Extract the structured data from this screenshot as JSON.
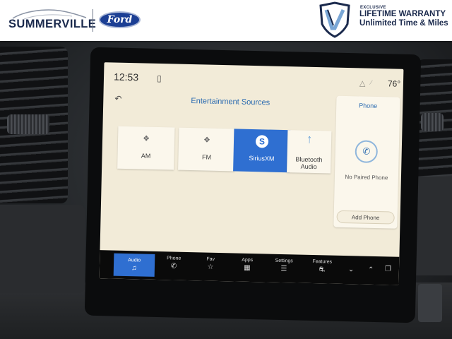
{
  "banner": {
    "dealer_name": "SUMMERVILLE",
    "brand_logo_text": "Ford",
    "warranty_eyebrow": "EXCLUSIVE",
    "warranty_title": "LIFETIME WARRANTY",
    "warranty_subtitle": "Unlimited Time & Miles"
  },
  "status_bar": {
    "time": "12:53",
    "temperature": "76°",
    "icons": [
      "phone-projection-icon",
      "wifi-icon",
      "signal-icon"
    ]
  },
  "header": {
    "back_icon": "back-arrow-icon",
    "title": "Entertainment Sources"
  },
  "sources": [
    {
      "label": "AM",
      "icon": "broadcast-icon",
      "selected": false
    },
    {
      "label": "FM",
      "icon": "broadcast-icon",
      "selected": false
    },
    {
      "label": "SiriusXM",
      "icon": "siriusxm-icon",
      "selected": true
    },
    {
      "label": "Bluetooth Audio",
      "icon": "bluetooth-icon",
      "selected": false
    }
  ],
  "phone_panel": {
    "title": "Phone",
    "status": "No Paired Phone",
    "add_button": "Add Phone"
  },
  "bottom_nav": {
    "items": [
      {
        "label": "Audio",
        "icon": "music-note-icon",
        "active": true
      },
      {
        "label": "Phone",
        "icon": "phone-icon",
        "active": false
      },
      {
        "label": "Fav",
        "icon": "star-icon",
        "active": false
      },
      {
        "label": "Apps",
        "icon": "apps-grid-icon",
        "active": false
      },
      {
        "label": "Settings",
        "icon": "sliders-icon",
        "active": false
      },
      {
        "label": "Features",
        "icon": "car-icon",
        "active": false
      }
    ],
    "extra_icons": [
      "chevron-down-icon",
      "chevron-up-icon",
      "split-screen-icon"
    ]
  },
  "colors": {
    "screen_bg": "#f2ebd8",
    "accent_blue": "#2f6fd1",
    "title_blue": "#2a6ab0",
    "dealer_navy": "#1b2a4d",
    "ford_blue": "#1c3f94"
  }
}
